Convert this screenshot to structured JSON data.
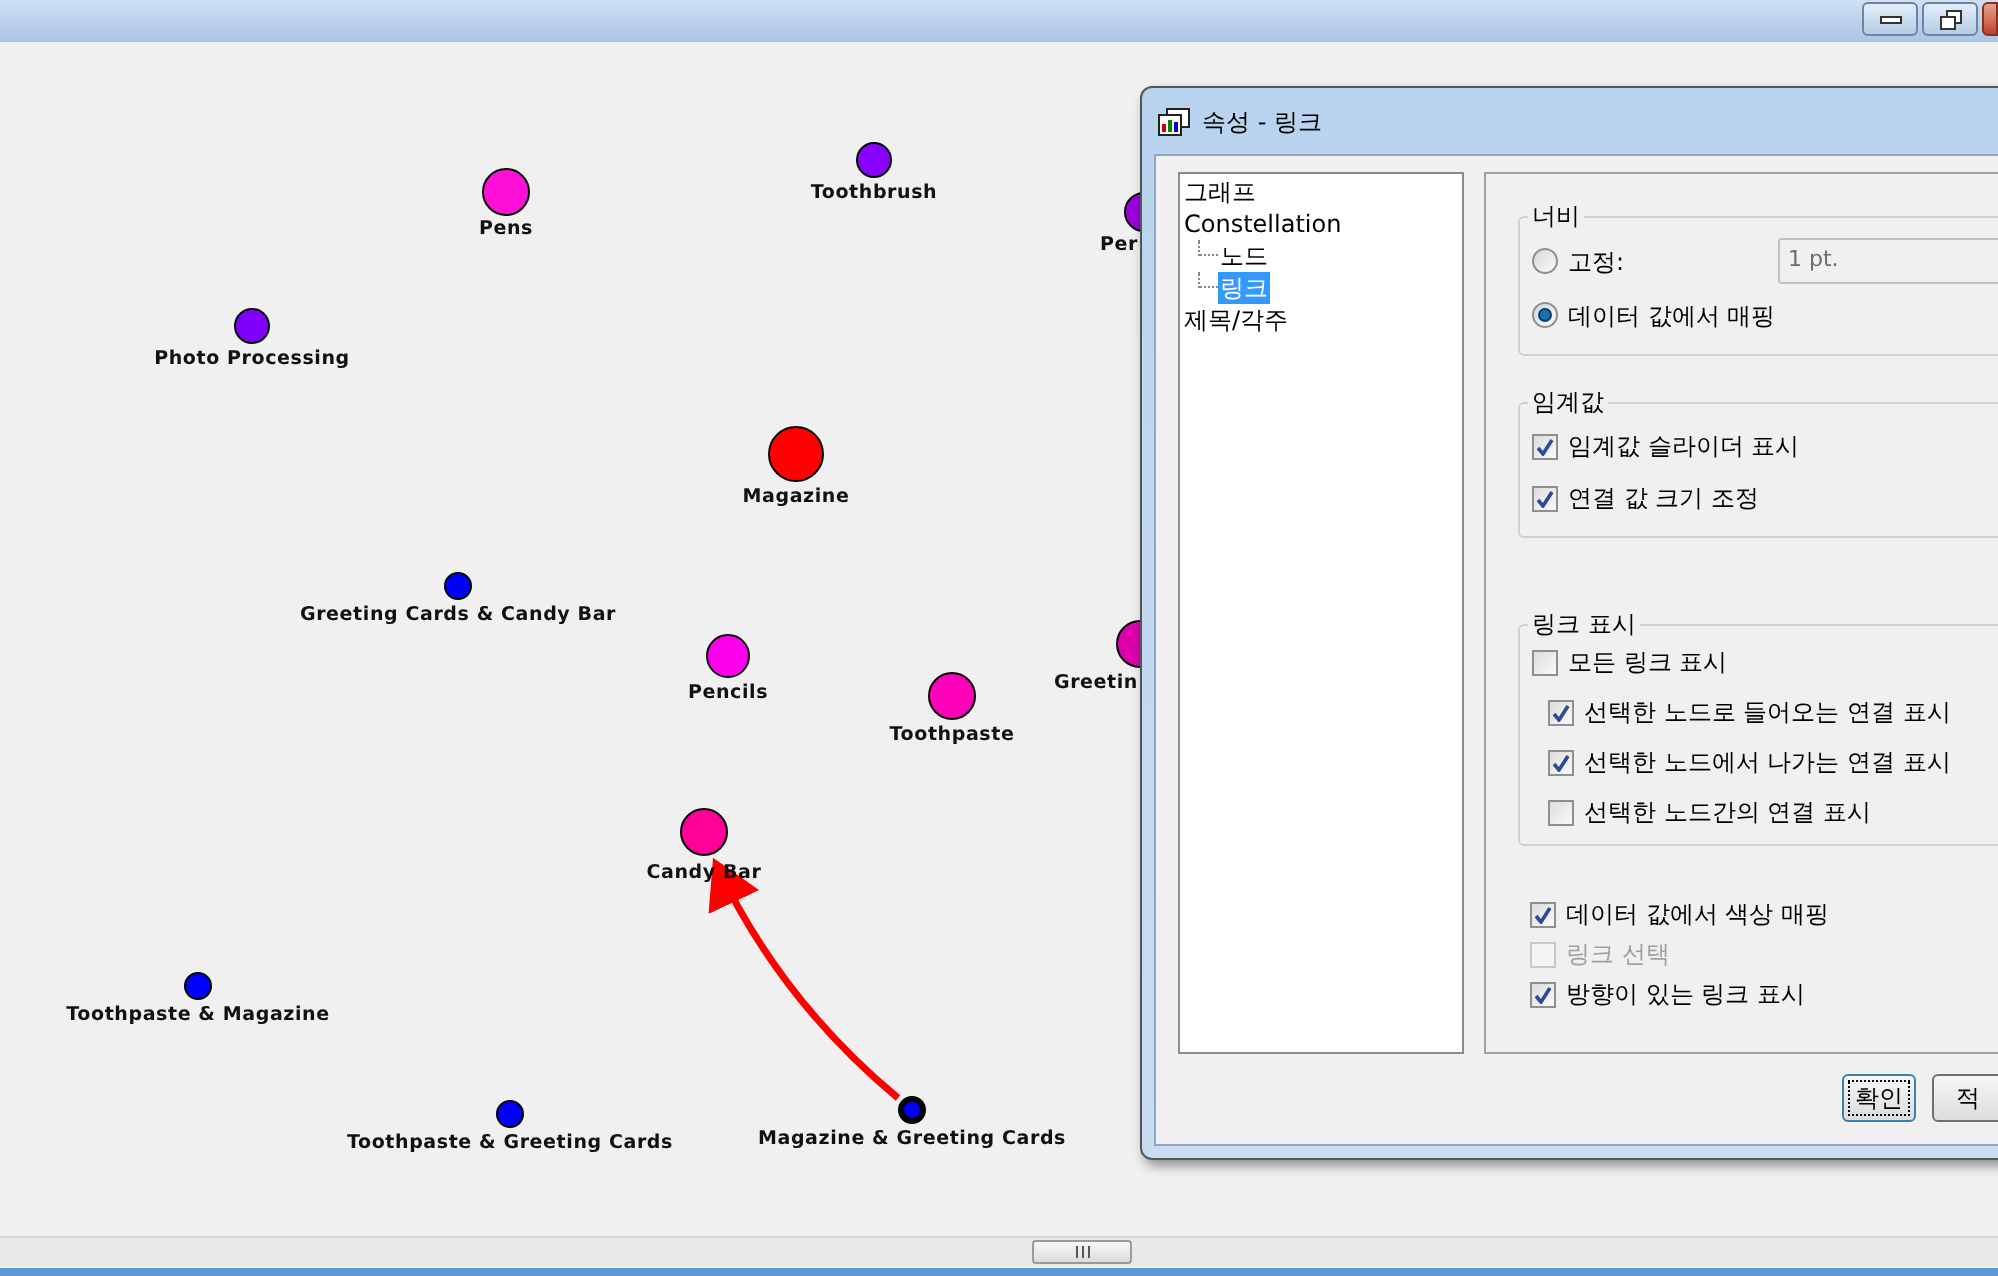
{
  "graph": {
    "nodes": [
      {
        "label": "Pens",
        "color": "#ff10d8",
        "selected": false
      },
      {
        "label": "Toothbrush",
        "color": "#8800ff",
        "selected": false
      },
      {
        "label": "Per",
        "color": "#9900dd",
        "selected": false
      },
      {
        "label": "Photo Processing",
        "color": "#8000ff",
        "selected": false
      },
      {
        "label": "Magazine",
        "color": "#ff0000",
        "selected": false
      },
      {
        "label": "Greeting Cards & Candy Bar",
        "color": "#0000ff",
        "selected": false
      },
      {
        "label": "Pencils",
        "color": "#ff00ee",
        "selected": false
      },
      {
        "label": "Toothpaste",
        "color": "#ff00bb",
        "selected": false
      },
      {
        "label": "Greetin",
        "color": "#dd00aa",
        "selected": false
      },
      {
        "label": "Candy Bar",
        "color": "#ff0099",
        "selected": false
      },
      {
        "label": "Toothpaste & Magazine",
        "color": "#0000ff",
        "selected": false
      },
      {
        "label": "Toothpaste & Greeting Cards",
        "color": "#0000ff",
        "selected": false
      },
      {
        "label": "Magazine & Greeting Cards",
        "color": "#0000ff",
        "selected": true
      }
    ]
  },
  "dialog": {
    "title": "속성 - 링크",
    "tree": [
      {
        "label": "그래프",
        "selected": false
      },
      {
        "label": "Constellation",
        "selected": false,
        "children": [
          {
            "label": "노드",
            "selected": false
          },
          {
            "label": "링크",
            "selected": true
          }
        ]
      },
      {
        "label": "제목/각주",
        "selected": false
      }
    ],
    "width_group": {
      "title": "너비",
      "options": [
        {
          "label": "고정:",
          "selected": false,
          "field": {
            "value": "1 pt.",
            "disabled": true
          }
        },
        {
          "label": "데이터 값에서 매핑",
          "selected": true
        }
      ]
    },
    "threshold_group": {
      "title": "임계값",
      "options": [
        {
          "label": "임계값 슬라이더 표시",
          "checked": true,
          "disabled": false
        },
        {
          "label": "연결 값 크기 조정",
          "checked": true,
          "disabled": false
        }
      ]
    },
    "link_display_group": {
      "title": "링크 표시",
      "options": [
        {
          "label": "모든 링크 표시",
          "checked": false,
          "disabled": false,
          "children": [
            {
              "label": "선택한 노드로 들어오는 연결 표시",
              "checked": true,
              "disabled": false
            },
            {
              "label": "선택한 노드에서 나가는 연결 표시",
              "checked": true,
              "disabled": false
            },
            {
              "label": "선택한 노드간의 연결 표시",
              "checked": false,
              "disabled": false
            }
          ]
        }
      ]
    },
    "options": [
      {
        "label": "데이터 값에서 색상 매핑",
        "checked": true,
        "disabled": false
      },
      {
        "label": "링크 선택",
        "checked": false,
        "disabled": true
      },
      {
        "label": "방향이 있는 링크 표시",
        "checked": true,
        "disabled": false
      }
    ],
    "buttons": [
      {
        "label": "확인",
        "selected": true
      },
      {
        "label": "적",
        "selected": false
      }
    ]
  }
}
